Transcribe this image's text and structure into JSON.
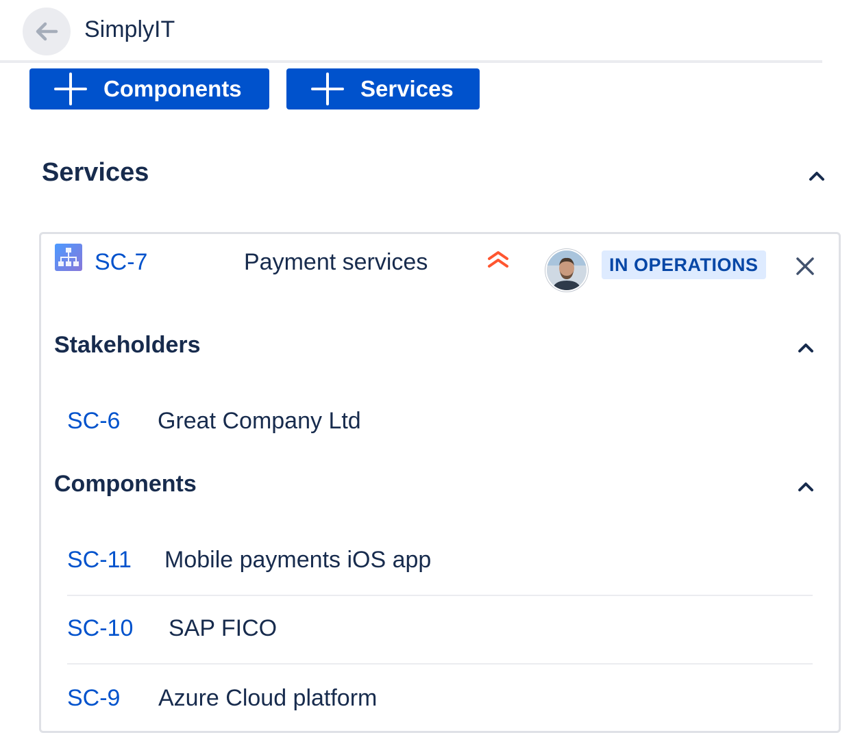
{
  "header": {
    "title": "SimplyIT",
    "back_icon": "arrow-left-icon"
  },
  "actions": {
    "components_label": "Components",
    "services_label": "Services"
  },
  "services_section": {
    "title": "Services",
    "service": {
      "key": "SC-7",
      "name": "Payment services",
      "priority_icon": "priority-highest-icon",
      "priority_color": "#ff5630",
      "status": "IN OPERATIONS",
      "status_bg": "#deebff",
      "status_color": "#0747a6",
      "stakeholders": {
        "title": "Stakeholders",
        "items": [
          {
            "key": "SC-6",
            "name": "Great Company Ltd"
          }
        ]
      },
      "components": {
        "title": "Components",
        "items": [
          {
            "key": "SC-11",
            "name": "Mobile payments iOS app"
          },
          {
            "key": "SC-10",
            "name": "SAP FICO"
          },
          {
            "key": "SC-9",
            "name": "Azure Cloud platform"
          }
        ]
      }
    }
  },
  "colors": {
    "primary": "#0052cc",
    "text": "#172b4d",
    "border": "#dfe1e6"
  }
}
